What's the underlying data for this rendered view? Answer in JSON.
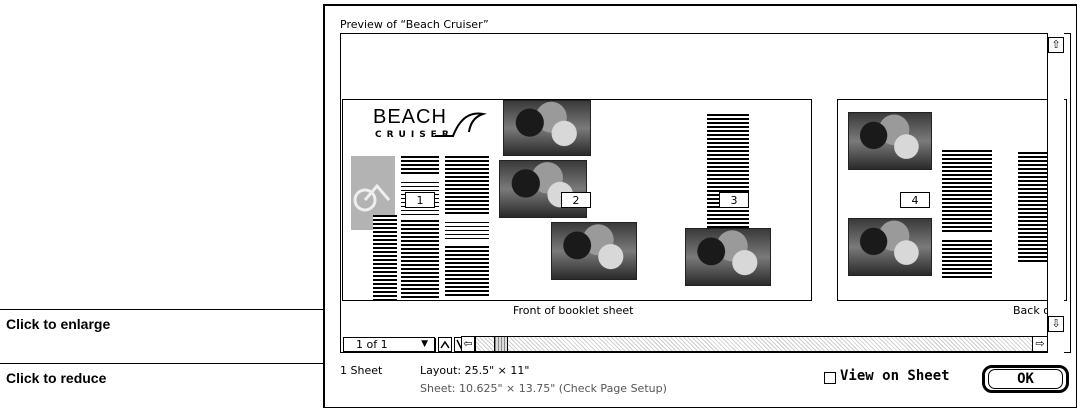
{
  "callouts": {
    "enlarge": "Click to enlarge",
    "reduce": "Click to reduce"
  },
  "window": {
    "title": "Preview of “Beach Cruiser”"
  },
  "preview": {
    "logo_word": "BEACH",
    "logo_sub": "CRUISER",
    "pages": [
      "1",
      "2",
      "3",
      "4"
    ],
    "front_label": "Front of booklet sheet",
    "back_label": "Back o"
  },
  "toolbar": {
    "page_select_value": "1 of 1",
    "enlarge_icon": "zoom-in-arrow",
    "reduce_icon": "zoom-out-arrow"
  },
  "footer": {
    "sheet_count": "1 Sheet",
    "layout": "Layout: 25.5\" × 11\"",
    "sheet_size": "Sheet: 10.625\" × 13.75\" (Check Page Setup)",
    "view_on_sheet_label": "View on Sheet",
    "view_on_sheet_checked": false,
    "ok_label": "OK"
  }
}
